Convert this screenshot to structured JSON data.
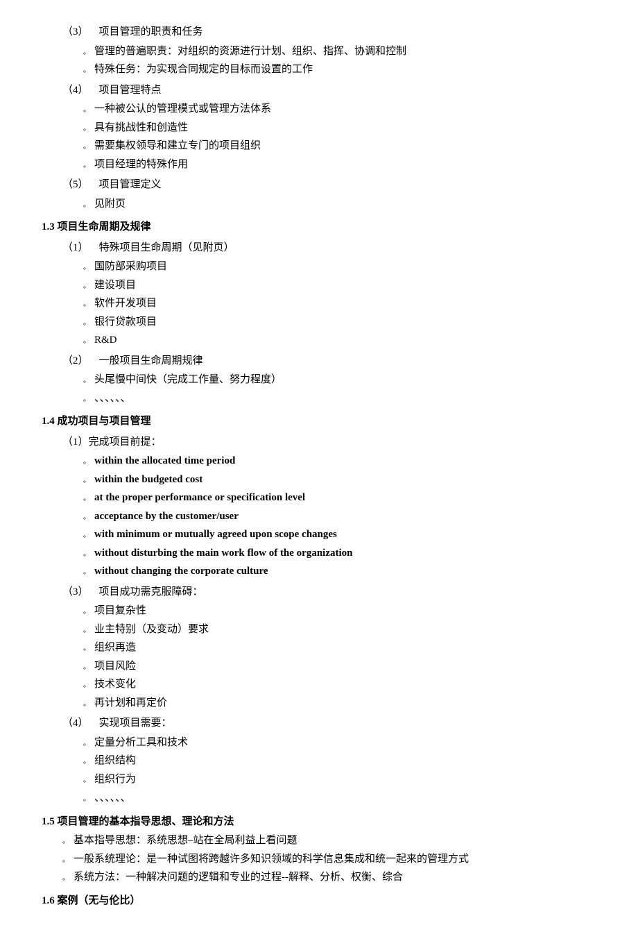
{
  "content": {
    "sections": [
      {
        "id": "s3",
        "label": "（3）",
        "title": "项目管理的职责和任务",
        "items": [
          {
            "bullet": "。",
            "text": "管理的普遍职责：对组织的资源进行计划、组织、指挥、协调和控制"
          },
          {
            "bullet": "。",
            "text": "特殊任务：为实现合同规定的目标而设置的工作"
          }
        ]
      },
      {
        "id": "s4",
        "label": "（4）",
        "title": "项目管理特点",
        "items": [
          {
            "bullet": "。",
            "text": "一种被公认的管理模式或管理方法体系"
          },
          {
            "bullet": "。",
            "text": "具有挑战性和创造性"
          },
          {
            "bullet": "。",
            "text": "需要集权领导和建立专门的项目组织"
          },
          {
            "bullet": "。",
            "text": "项目经理的特殊作用"
          }
        ]
      },
      {
        "id": "s5",
        "label": "（5）",
        "title": "项目管理定义",
        "items": [
          {
            "bullet": "。",
            "text": "见附页"
          }
        ]
      }
    ],
    "section13": {
      "heading": "1.3  项目生命周期及规律",
      "sub1": {
        "label": "（1）",
        "title": "特殊项目生命周期（见附页）",
        "items": [
          {
            "bullet": "。",
            "text": "国防部采购项目"
          },
          {
            "bullet": "。",
            "text": "建设项目"
          },
          {
            "bullet": "。",
            "text": "软件开发项目"
          },
          {
            "bullet": "。",
            "text": "银行贷款项目"
          },
          {
            "bullet": "。",
            "text": "R&D"
          }
        ]
      },
      "sub2": {
        "label": "（2）",
        "title": "一般项目生命周期规律",
        "items": [
          {
            "bullet": "。",
            "text": "头尾慢中间快（完成工作量、努力程度）"
          },
          {
            "bullet": "。",
            "text": "、、、、、、"
          }
        ]
      }
    },
    "section14": {
      "heading": "1.4 成功项目与项目管理",
      "sub1": {
        "label": "（1）完成项目前提：",
        "items": [
          {
            "bullet": "。",
            "text": "within the allocated time period",
            "bold": true
          },
          {
            "bullet": "。",
            "text": "within the budgeted cost",
            "bold": true
          },
          {
            "bullet": "。",
            "text": "at the proper performance or specification level",
            "bold": true
          },
          {
            "bullet": "。",
            "text": "acceptance by the customer/user",
            "bold": true
          },
          {
            "bullet": "。",
            "text": "with minimum or mutually agreed upon scope changes",
            "bold": true
          },
          {
            "bullet": "。",
            "text": "without disturbing the main work flow of the organization",
            "bold": true
          },
          {
            "bullet": "。",
            "text": "without changing the corporate culture",
            "bold": true
          }
        ]
      },
      "sub3": {
        "label": "（3）",
        "title": "项目成功需克服障碍：",
        "items": [
          {
            "bullet": "。",
            "text": "项目复杂性"
          },
          {
            "bullet": "。",
            "text": "业主特别（及变动）要求"
          },
          {
            "bullet": "。",
            "text": "组织再造"
          },
          {
            "bullet": "。",
            "text": "项目风险"
          },
          {
            "bullet": "。",
            "text": "技术变化"
          },
          {
            "bullet": "。",
            "text": "再计划和再定价"
          }
        ]
      },
      "sub4": {
        "label": "（4）",
        "title": "实现项目需要：",
        "items": [
          {
            "bullet": "。",
            "text": "定量分析工具和技术"
          },
          {
            "bullet": "。",
            "text": "组织结构"
          },
          {
            "bullet": "。",
            "text": "组织行为"
          }
        ]
      },
      "ellipsis": "、、、、、、"
    },
    "section15": {
      "heading": "1.5 项目管理的基本指导思想、理论和方法",
      "items": [
        {
          "bullet": "。",
          "text": "基本指导思想：系统思想–站在全局利益上看问题"
        },
        {
          "bullet": "。",
          "text": "一般系统理论：是一种试图将跨越许多知识领域的科学信息集成和统一起来的管理方式"
        },
        {
          "bullet": "。",
          "text": "系统方法：一种解决问题的逻辑和专业的过程--解释、分析、权衡、综合"
        }
      ]
    },
    "section16": {
      "heading": "1.6  案例（无与伦比）"
    }
  }
}
